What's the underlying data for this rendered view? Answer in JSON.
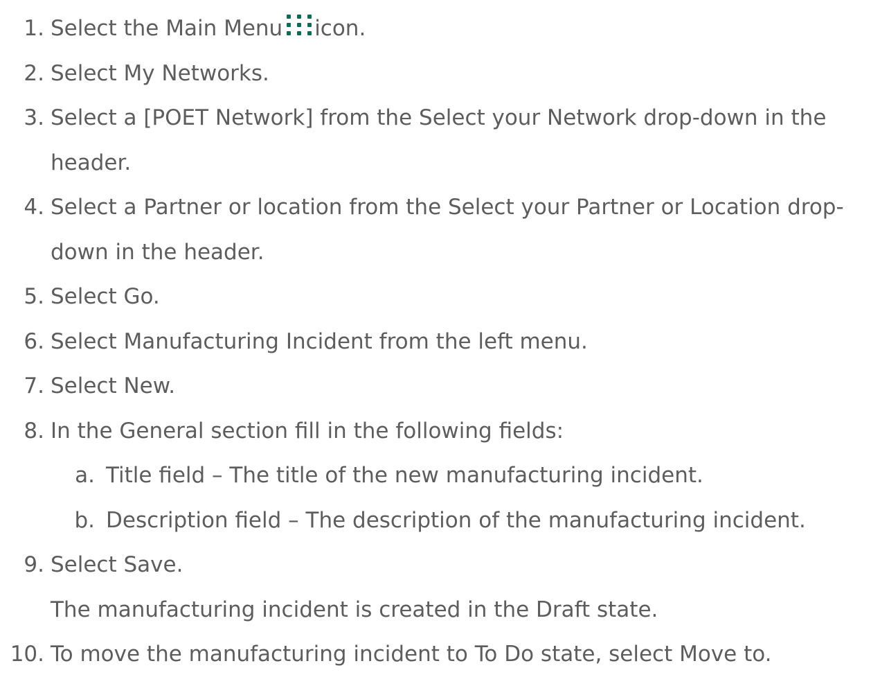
{
  "icons": {
    "main_menu": "nine-dot-grid-icon",
    "main_menu_color": "#0f6b55"
  },
  "steps": [
    {
      "num": "1.",
      "before": "Select the Main Menu",
      "after": "icon."
    },
    {
      "num": "2.",
      "text": "Select My Networks."
    },
    {
      "num": "3.",
      "text": "Select a [POET Network] from the Select your Network drop-down in the header."
    },
    {
      "num": "4.",
      "text": "Select a Partner or location from the Select your Partner or Location drop-down in the header."
    },
    {
      "num": "5.",
      "text": "Select Go."
    },
    {
      "num": "6.",
      "text": "Select Manufacturing Incident from the left menu."
    },
    {
      "num": "7.",
      "text": "Select New."
    },
    {
      "num": "8.",
      "text": "In the General section fill in the following fields:",
      "sub": [
        {
          "letter": "a.",
          "text": "Title field – The title of the new manufacturing incident."
        },
        {
          "letter": "b.",
          "text": "Description field – The description of the manufacturing incident."
        }
      ]
    },
    {
      "num": "9.",
      "text": "Select Save.",
      "note": "The manufacturing incident is created in the Draft state."
    },
    {
      "num": "10.",
      "text": "To move the manufacturing incident to To Do state, select Move to."
    }
  ]
}
